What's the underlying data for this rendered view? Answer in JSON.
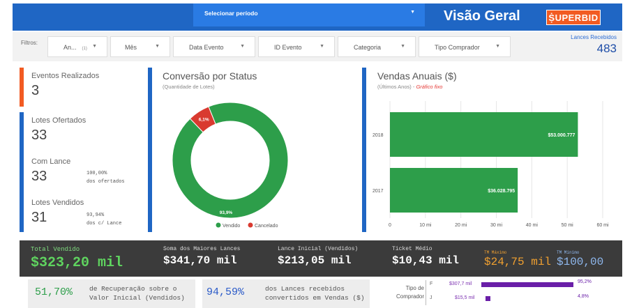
{
  "header": {
    "period_label": "Selecionar período",
    "title": "Visão Geral",
    "brand": "ṨUPERBID",
    "colors": {
      "header_bg": "#1f66c4",
      "brand_bg": "#f25b22"
    }
  },
  "filters": {
    "label": "Filtros:",
    "items": [
      {
        "label": "An...",
        "badge": "(1)"
      },
      {
        "label": "Mês"
      },
      {
        "label": "Data Evento"
      },
      {
        "label": "ID Evento"
      },
      {
        "label": "Categoria"
      },
      {
        "label": "Tipo Comprador"
      }
    ],
    "lances_label": "Lances Recebidos",
    "lances_value": "483"
  },
  "kpis": {
    "eventos": {
      "label": "Eventos Realizados",
      "value": "3"
    },
    "lotes_ofertados": {
      "label": "Lotes Ofertados",
      "value": "33"
    },
    "com_lance": {
      "label": "Com Lance",
      "value": "33",
      "side_value": "100,00%",
      "side_label": "dos ofertados"
    },
    "lotes_vendidos": {
      "label": "Lotes Vendidos",
      "value": "31",
      "side_value": "93,94%",
      "side_label": "dos c/ Lance"
    }
  },
  "conversao": {
    "title": "Conversão por Status",
    "subtitle": "(Quantidade de Lotes)",
    "chart_data": {
      "type": "pie",
      "title": "Conversão por Status",
      "slices": [
        {
          "name": "Vendido",
          "value": 93.9,
          "label": "93,9%",
          "color": "#2d9e4a"
        },
        {
          "name": "Cancelado",
          "value": 6.1,
          "label": "6,1%",
          "color": "#d93a30"
        }
      ]
    }
  },
  "vendas": {
    "title": "Vendas Anuais ($)",
    "subtitle": "(Últimos Anos) - ",
    "subtitle_fixo": "Gráfico fixo",
    "chart_data": {
      "type": "bar",
      "orientation": "horizontal",
      "categories": [
        "2018",
        "2017"
      ],
      "values": [
        53000777,
        36028795
      ],
      "value_labels": [
        "$53.000.777",
        "$36.028.795"
      ],
      "xticks": [
        "0",
        "10 mi",
        "20 mi",
        "30 mi",
        "40 mi",
        "50 mi",
        "60 mi"
      ],
      "xlim": [
        0,
        60000000
      ],
      "color": "#2d9e4a"
    }
  },
  "summary": {
    "total_vendido": {
      "label": "Total Vendido",
      "value": "$323,20 mil"
    },
    "maiores_lances": {
      "label": "Soma dos Maiores Lances",
      "value": "$341,70 mil"
    },
    "lance_inicial": {
      "label": "Lance Inicial (Vendidos)",
      "value": "$213,05 mil"
    },
    "ticket_medio": {
      "label": "Ticket Médio",
      "value": "$10,43 mil"
    },
    "tm_maximo": {
      "label": "TM Máximo",
      "value": "$24,75 mil"
    },
    "tm_minimo": {
      "label": "TM Mínimo",
      "value": "$100,00"
    }
  },
  "recuperacao": {
    "pct": "51,70%",
    "text": "de Recuperação sobre o Valor Inicial (Vendidos)"
  },
  "conversao_lances": {
    "pct": "94,59%",
    "text": "dos Lances recebidos convertidos em Vendas ($)"
  },
  "tipo_comprador": {
    "label": "Tipo de Comprador",
    "chart_data": {
      "type": "bar",
      "orientation": "horizontal",
      "categories": [
        "F",
        "J"
      ],
      "values": [
        307.7,
        15.5
      ],
      "value_labels": [
        "$307,7 mil",
        "$15,5 mil"
      ],
      "percents": [
        "95,2%",
        "4,8%"
      ],
      "color": "#6a1fa8"
    }
  }
}
